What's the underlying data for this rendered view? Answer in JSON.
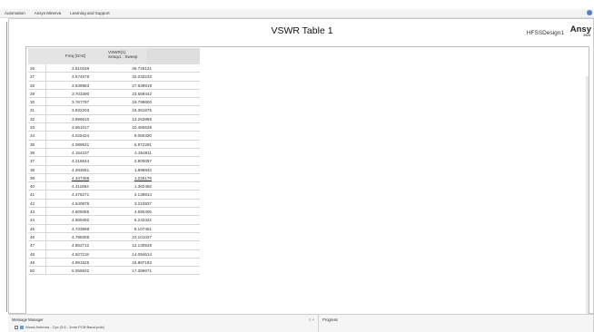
{
  "menubar": {
    "items": [
      "Automation",
      "Ansys Minerva",
      "Learning and Support"
    ]
  },
  "report": {
    "title": "VSWR Table 1",
    "design": "HFSSDesign1",
    "brand": "Ansy",
    "brand_year": "2023"
  },
  "table": {
    "header_freq": "Freq [GHz]",
    "header_vswr": "VSWR(1)",
    "header_vswr_sub": "Setup1 : Sweep",
    "rows": [
      {
        "idx": "26",
        "freq": "3.510169",
        "vswr": "36.726131"
      },
      {
        "idx": "27",
        "freq": "3.574576",
        "vswr": "32.033232"
      },
      {
        "idx": "28",
        "freq": "3.638983",
        "vswr": "27.639919"
      },
      {
        "idx": "29",
        "freq": "3.703390",
        "vswr": "23.559442"
      },
      {
        "idx": "30",
        "freq": "3.767797",
        "vswr": "19.798600"
      },
      {
        "idx": "31",
        "freq": "3.832203",
        "vswr": "16.361875"
      },
      {
        "idx": "32",
        "freq": "3.896610",
        "vswr": "13.253865"
      },
      {
        "idx": "33",
        "freq": "3.961017",
        "vswr": "10.480639"
      },
      {
        "idx": "34",
        "freq": "4.025424",
        "vswr": "8.050320"
      },
      {
        "idx": "35",
        "freq": "4.089831",
        "vswr": "5.972291"
      },
      {
        "idx": "36",
        "freq": "4.154237",
        "vswr": "4.264811"
      },
      {
        "idx": "37",
        "freq": "4.218644",
        "vswr": "2.900057"
      },
      {
        "idx": "38",
        "freq": "4.283051",
        "vswr": "1.896943"
      },
      {
        "idx": "39",
        "freq": "4.347458",
        "vswr": "1.228176"
      },
      {
        "idx": "40",
        "freq": "4.411864",
        "vswr": "1.362452"
      },
      {
        "idx": "41",
        "freq": "4.476271",
        "vswr": "2.139814"
      },
      {
        "idx": "42",
        "freq": "4.540678",
        "vswr": "3.210837"
      },
      {
        "idx": "43",
        "freq": "4.605085",
        "vswr": "4.690406"
      },
      {
        "idx": "44",
        "freq": "4.669492",
        "vswr": "6.243422"
      },
      {
        "idx": "45",
        "freq": "4.733898",
        "vswr": "8.107451"
      },
      {
        "idx": "46",
        "freq": "4.798305",
        "vswr": "10.101037"
      },
      {
        "idx": "47",
        "freq": "4.862712",
        "vswr": "12.130528"
      },
      {
        "idx": "48",
        "freq": "4.927119",
        "vswr": "14.094614"
      },
      {
        "idx": "49",
        "freq": "4.991525",
        "vswr": "15.887182"
      },
      {
        "idx": "50",
        "freq": "5.055932",
        "vswr": "17.399671"
      }
    ]
  },
  "panes": {
    "message_title": "Message Manager",
    "message_controls": "≡ ×",
    "message_entry": "Wood Antenna - Cyc (3.6 - 1mm PCB Band-pole)",
    "progress_title": "Progress"
  }
}
